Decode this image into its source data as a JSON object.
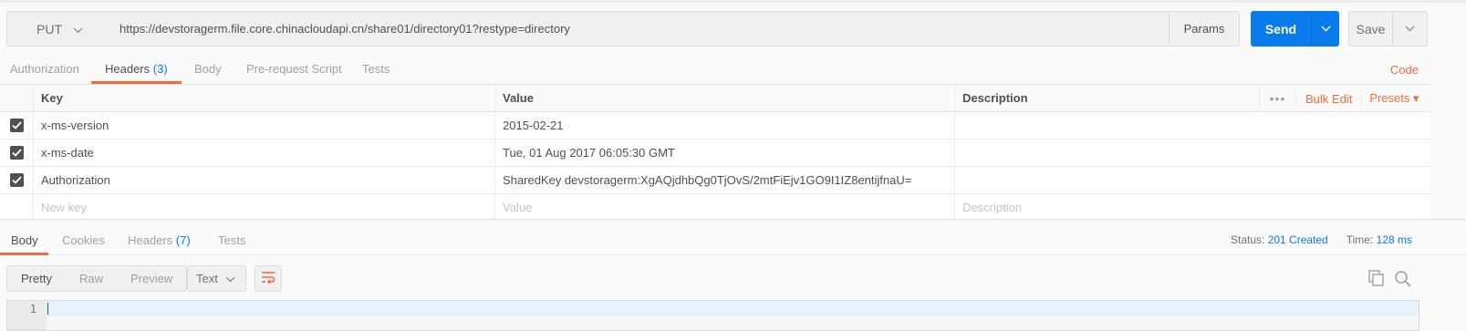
{
  "request": {
    "method": "PUT",
    "url": "https://devstoragerm.file.core.chinacloudapi.cn/share01/directory01?restype=directory",
    "params_label": "Params",
    "send_label": "Send",
    "save_label": "Save"
  },
  "request_tabs": {
    "authorization": "Authorization",
    "headers": "Headers",
    "headers_count": "(3)",
    "body": "Body",
    "prerequest": "Pre-request Script",
    "tests": "Tests",
    "code": "Code"
  },
  "headers_table": {
    "col_key": "Key",
    "col_value": "Value",
    "col_description": "Description",
    "more": "•••",
    "bulk_edit": "Bulk Edit",
    "presets": "Presets ▾",
    "rows": [
      {
        "key": "x-ms-version",
        "value": "2015-02-21",
        "description": "",
        "checked": true
      },
      {
        "key": "x-ms-date",
        "value": "Tue, 01 Aug 2017 06:05:30 GMT",
        "description": "",
        "checked": true
      },
      {
        "key": "Authorization",
        "value": "SharedKey devstoragerm:XgAQjdhbQg0TjOvS/2mtFiEjv1GO9I1IZ8entijfnaU=",
        "description": "",
        "checked": true
      }
    ],
    "new_key_placeholder": "New key",
    "new_value_placeholder": "Value",
    "new_description_placeholder": "Description"
  },
  "response_tabs": {
    "body": "Body",
    "cookies": "Cookies",
    "headers": "Headers",
    "headers_count": "(7)",
    "tests": "Tests"
  },
  "response_status": {
    "status_label": "Status:",
    "status_value": "201 Created",
    "time_label": "Time:",
    "time_value": "128 ms"
  },
  "body_view": {
    "modes": [
      "Pretty",
      "Raw",
      "Preview"
    ],
    "active_mode": "Pretty",
    "format": "Text",
    "line_numbers": [
      "1"
    ]
  },
  "colors": {
    "accent": "#f26b3a",
    "send": "#097bed",
    "link": "#097bed"
  }
}
